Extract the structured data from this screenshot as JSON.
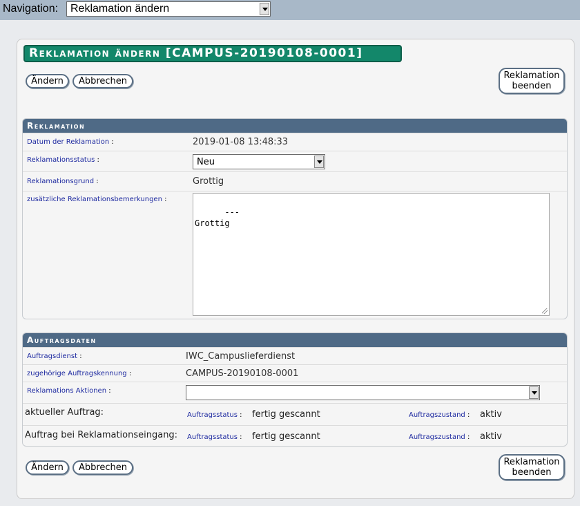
{
  "nav": {
    "label": "Navigation:",
    "selected": "Reklamation ändern"
  },
  "title": "Reklamation ändern [CAMPUS-20190108-0001]",
  "buttons": {
    "change": "Ändern",
    "cancel": "Abbrechen",
    "finish": "Reklamation beenden"
  },
  "reklamation": {
    "header": "Reklamation",
    "date_label": "Datum der Reklamation",
    "date_value": "2019-01-08 13:48:33",
    "status_label": "Reklamationsstatus",
    "status_value": "Neu",
    "reason_label": "Reklamationsgrund",
    "reason_value": "Grottig",
    "remarks_label": "zusätzliche Reklamationsbemerkungen",
    "remarks_value": "---\nGrottig"
  },
  "auftrag": {
    "header": "Auftragsdaten",
    "service_label": "Auftragsdienst",
    "service_value": "IWC_Campuslieferdienst",
    "id_label": "zugehörige Auftragskennung",
    "id_value": "CAMPUS-20190108-0001",
    "actions_label": "Reklamations Aktionen",
    "actions_value": "",
    "current_label": "aktueller Auftrag:",
    "at_claim_label": "Auftrag bei Reklamationseingang:",
    "status_label": "Auftragsstatus",
    "condition_label": "Auftragszustand",
    "current_status": "fertig gescannt",
    "current_condition": "aktiv",
    "claim_status": "fertig gescannt",
    "claim_condition": "aktiv"
  },
  "colon": ":"
}
